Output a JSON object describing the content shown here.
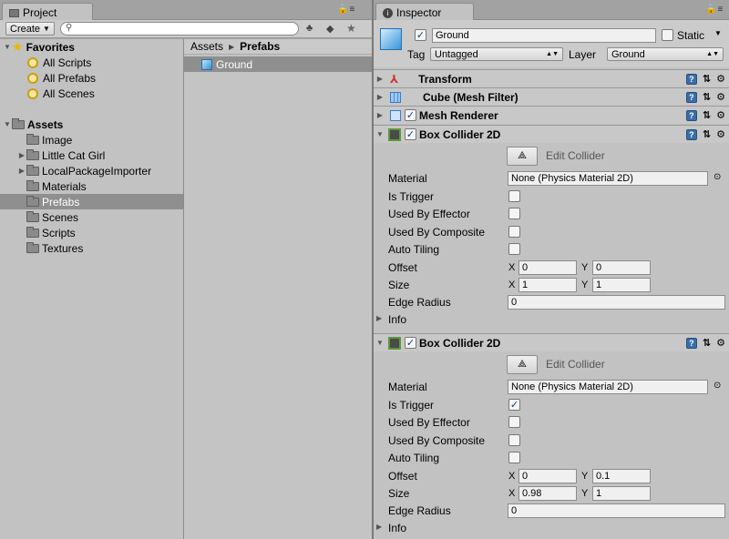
{
  "project": {
    "tab_label": "Project",
    "create_label": "Create",
    "favorites": {
      "label": "Favorites",
      "items": [
        "All Scripts",
        "All Prefabs",
        "All Scenes"
      ]
    },
    "assets": {
      "label": "Assets",
      "items": [
        {
          "label": "Image",
          "expandable": false
        },
        {
          "label": "Little Cat Girl",
          "expandable": true
        },
        {
          "label": "LocalPackageImporter",
          "expandable": true
        },
        {
          "label": "Materials",
          "expandable": false
        },
        {
          "label": "Prefabs",
          "expandable": false,
          "selected": true
        },
        {
          "label": "Scenes",
          "expandable": false
        },
        {
          "label": "Scripts",
          "expandable": false
        },
        {
          "label": "Textures",
          "expandable": false
        }
      ]
    },
    "breadcrumb": {
      "root": "Assets",
      "separator": "▶",
      "current": "Prefabs"
    },
    "files": [
      "Ground"
    ]
  },
  "inspector": {
    "tab_label": "Inspector",
    "object_name": "Ground",
    "static_label": "Static",
    "tag_label": "Tag",
    "tag_value": "Untagged",
    "layer_label": "Layer",
    "layer_value": "Ground",
    "components": {
      "transform": "Transform",
      "mesh_filter": "Cube (Mesh Filter)",
      "mesh_renderer": "Mesh Renderer"
    },
    "colliders": [
      {
        "title": "Box Collider 2D",
        "edit_label": "Edit Collider",
        "material_label": "Material",
        "material_value": "None (Physics Material 2D)",
        "is_trigger_label": "Is Trigger",
        "is_trigger": false,
        "used_by_effector_label": "Used By Effector",
        "used_by_composite_label": "Used By Composite",
        "auto_tiling_label": "Auto Tiling",
        "offset_label": "Offset",
        "offset_x": "0",
        "offset_y": "0",
        "size_label": "Size",
        "size_x": "1",
        "size_y": "1",
        "edge_radius_label": "Edge Radius",
        "edge_radius": "0",
        "info_label": "Info"
      },
      {
        "title": "Box Collider 2D",
        "edit_label": "Edit Collider",
        "material_label": "Material",
        "material_value": "None (Physics Material 2D)",
        "is_trigger_label": "Is Trigger",
        "is_trigger": true,
        "used_by_effector_label": "Used By Effector",
        "used_by_composite_label": "Used By Composite",
        "auto_tiling_label": "Auto Tiling",
        "offset_label": "Offset",
        "offset_x": "0",
        "offset_y": "0.1",
        "size_label": "Size",
        "size_x": "0.98",
        "size_y": "1",
        "edge_radius_label": "Edge Radius",
        "edge_radius": "0",
        "info_label": "Info"
      }
    ],
    "axis_x": "X",
    "axis_y": "Y"
  }
}
